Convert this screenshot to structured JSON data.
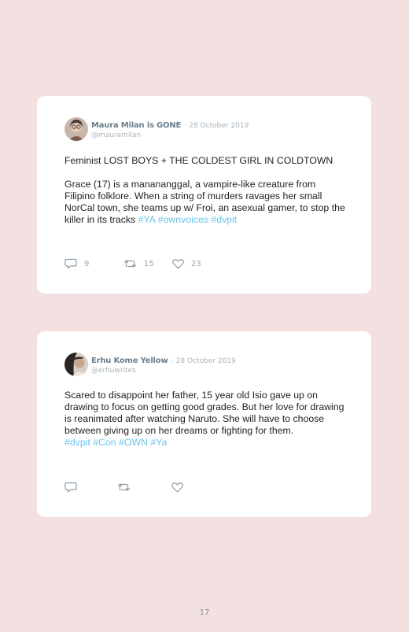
{
  "posts": [
    {
      "author_name": "Maura Milan is GONE",
      "date": "· 28 October 2019",
      "handle": "@mauramilan",
      "paragraph1": "Feminist LOST BOYS + THE COLDEST GIRL IN COLDTOWN",
      "paragraph2": "Grace (17) is a manananggal, a vampire-like creature from Filipino folklore. When a string of murders ravages her small NorCal town, she teams up w/ Froi, an asexual gamer, to stop the killer in its tracks",
      "hashtags": [
        "#YA",
        "#ownvoices",
        "#dvpit"
      ],
      "replies": "9",
      "retweets": "15",
      "likes": "23",
      "icons": {
        "reply": "speech-bubble-icon",
        "retweet": "retweet-arrows-icon",
        "like": "heart-icon"
      }
    },
    {
      "author_name": "Erhu Kome Yellow",
      "date": "· 28 October 2019",
      "handle": "@erhuwrites",
      "paragraph1": "Scared to disappoint her father, 15 year old Isio gave up on drawing to focus on getting good grades. But her love for drawing is reanimated after watching Naruto. She will have to choose between giving up on her dreams or fighting for them.",
      "hashtags": [
        "#dvpit",
        "#Con",
        "#OWN",
        "#Ya"
      ],
      "icons": {
        "reply": "speech-bubble-icon",
        "retweet": "retweet-arrows-icon",
        "like": "heart-icon"
      }
    }
  ],
  "page_number": "17",
  "colors": {
    "background": "#f3e1e1",
    "card": "#ffffff",
    "hashtag": "#6ec3e8",
    "name": "#6b7e8c",
    "muted": "#a9b4bc"
  }
}
